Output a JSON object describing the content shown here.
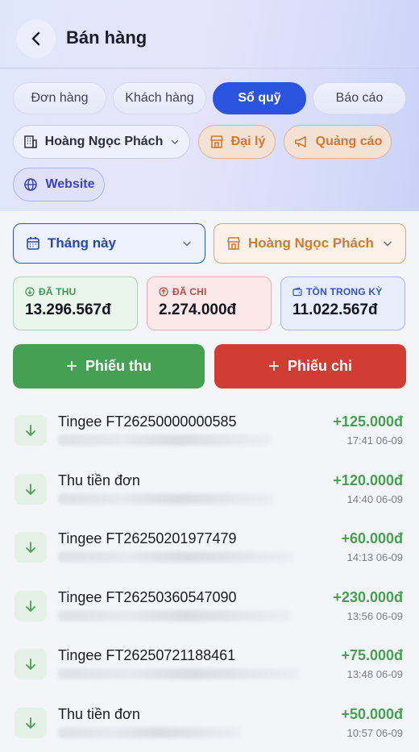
{
  "header": {
    "title": "Bán hàng"
  },
  "tabs": [
    {
      "label": "Đơn hàng",
      "active": false
    },
    {
      "label": "Khách hàng",
      "active": false
    },
    {
      "label": "Sổ quỹ",
      "active": true
    },
    {
      "label": "Báo cáo",
      "active": false
    }
  ],
  "chips": {
    "store": "Hoàng Ngọc Phách",
    "agency": "Đại lý",
    "ads": "Quảng cáo",
    "website": "Website"
  },
  "filters": {
    "period": "Tháng này",
    "store": "Hoàng Ngọc Phách"
  },
  "stats": {
    "income_label": "ĐÃ THU",
    "income_value": "13.296.567đ",
    "expense_label": "ĐÃ CHI",
    "expense_value": "2.274.000đ",
    "balance_label": "TỒN TRONG KỲ",
    "balance_value": "11.022.567đ"
  },
  "actions": {
    "receipt_label": "Phiếu thu",
    "payment_label": "Phiếu chi",
    "plus": "+"
  },
  "transactions": [
    {
      "title": "Tingee FT26250000000585",
      "amount": "+125.000đ",
      "time": "17:41 06-09"
    },
    {
      "title": "Thu tiền đơn",
      "amount": "+120.000đ",
      "time": "14:40 06-09"
    },
    {
      "title": "Tingee FT26250201977479",
      "amount": "+60.000đ",
      "time": "14:13 06-09"
    },
    {
      "title": "Tingee FT26250360547090",
      "amount": "+230.000đ",
      "time": "13:56 06-09"
    },
    {
      "title": "Tingee FT26250721188461",
      "amount": "+75.000đ",
      "time": "13:48 06-09"
    },
    {
      "title": "Thu tiền đơn",
      "amount": "+50.000đ",
      "time": "10:57 06-09"
    }
  ],
  "colors": {
    "primary": "#2a53e0",
    "income": "#46a053",
    "expense": "#d13c33",
    "accent_orange": "#d5772c"
  },
  "icons": {
    "back": "chevron-left-icon",
    "store": "building-icon",
    "agency": "storefront-icon",
    "ads": "megaphone-icon",
    "website": "globe-icon",
    "calendar": "calendar-icon",
    "income": "arrow-down-circle-icon",
    "expense": "arrow-up-circle-icon",
    "wallet": "wallet-icon",
    "transaction": "arrow-down-icon"
  }
}
